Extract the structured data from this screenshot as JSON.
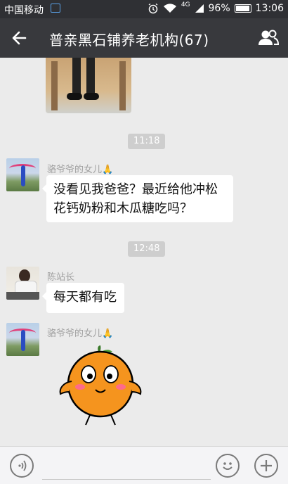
{
  "status_bar": {
    "carrier": "中国移动",
    "network": "4G",
    "battery": "96%",
    "time": "13:06"
  },
  "header": {
    "title": "普亲黑石铺养老机构(67)"
  },
  "messages": [
    {
      "time": "11:18"
    },
    {
      "sender": "骆爷爷的女儿🙏",
      "text_line1": "没看见我爸爸？最近给他冲松",
      "text_line2": "花钙奶粉和木瓜糖吃吗？"
    },
    {
      "time": "12:48"
    },
    {
      "sender": "陈站长",
      "text": "每天都有吃"
    },
    {
      "sender": "骆爷爷的女儿🙏"
    }
  ],
  "input": {
    "placeholder": ""
  },
  "colors": {
    "header_bg": "#38393d",
    "status_bg": "#2f3034",
    "chat_bg": "#ebebeb",
    "sticker_orange": "#f5941e"
  }
}
